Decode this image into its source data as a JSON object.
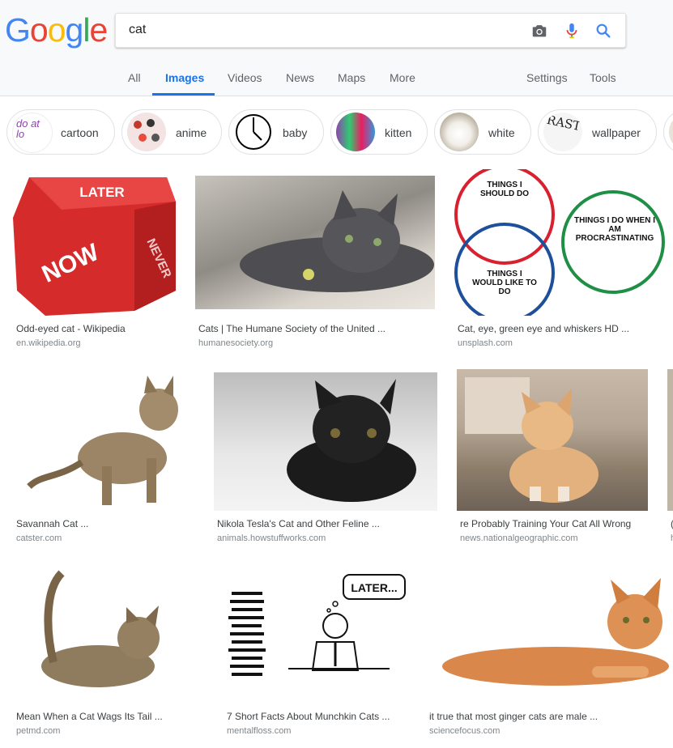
{
  "logo": {
    "letters": [
      "G",
      "o",
      "o",
      "g",
      "l",
      "e"
    ],
    "colors": [
      "#4285F4",
      "#EA4335",
      "#FBBC05",
      "#4285F4",
      "#34A853",
      "#EA4335"
    ]
  },
  "search": {
    "query": "cat"
  },
  "tabs": {
    "all": "All",
    "images": "Images",
    "videos": "Videos",
    "news": "News",
    "maps": "Maps",
    "more": "More",
    "settings": "Settings",
    "tools": "Tools"
  },
  "chips": [
    {
      "label": "cartoon",
      "thumb_text": "do at lo"
    },
    {
      "label": "anime"
    },
    {
      "label": "baby"
    },
    {
      "label": "kitten"
    },
    {
      "label": "white"
    },
    {
      "label": "wallpaper",
      "thumb_text": "RAST"
    }
  ],
  "results": [
    {
      "title": "Odd-eyed cat - Wikipedia",
      "source": "en.wikipedia.org",
      "img_text": {
        "top": "LATER",
        "front": "NOW",
        "side": "NEVER"
      }
    },
    {
      "title": "Cats | The Humane Society of the United ...",
      "source": "humanesociety.org"
    },
    {
      "title": "Cat, eye, green eye and whiskers HD ...",
      "source": "unsplash.com",
      "img_text": {
        "c1": "THINGS I SHOULD DO",
        "c2": "THINGS I DO WHEN I AM PROCRASTINATING",
        "c3": "THINGS I WOULD LIKE TO DO"
      }
    },
    {
      "title": "Savannah Cat ...",
      "source": "catster.com"
    },
    {
      "title": "Nikola Tesla's Cat and Other Feline ...",
      "source": "animals.howstuffworks.com"
    },
    {
      "title": "re Probably Training Your Cat All Wrong",
      "source": "news.nationalgeographic.com"
    },
    {
      "title": "Mean When a Cat Wags Its Tail ...",
      "source": "petmd.com"
    },
    {
      "title": "7 Short Facts About Munchkin Cats ...",
      "source": "mentalfloss.com",
      "img_text": {
        "bubble": "LATER..."
      }
    },
    {
      "title": "it true that most ginger cats are male ...",
      "source": "sciencefocus.com"
    }
  ],
  "partial": {
    "title_char": "(",
    "source_char": "h"
  },
  "icons": {
    "camera": "camera-icon",
    "mic": "microphone-icon",
    "search": "search-icon"
  }
}
